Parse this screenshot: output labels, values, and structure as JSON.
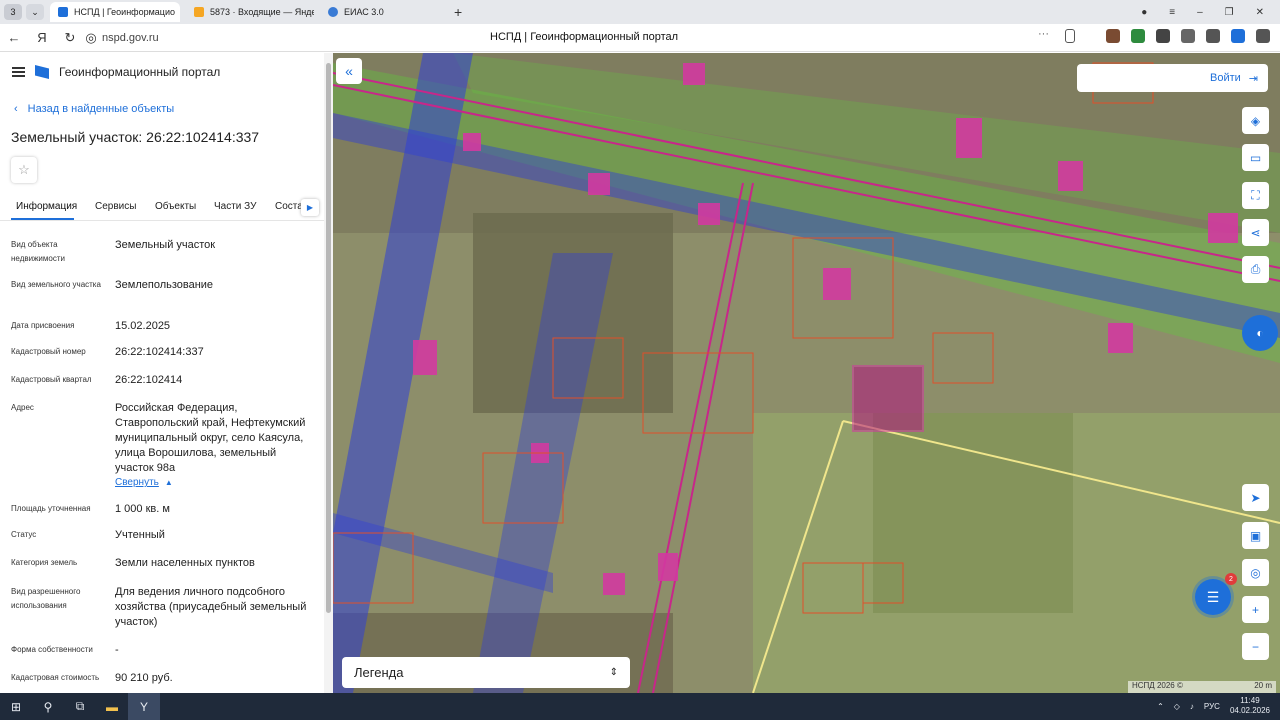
{
  "browser": {
    "tab_count": "3",
    "tabs": [
      {
        "label": "НСПД | Геоинформацио"
      },
      {
        "label": "5873 · Входящие — Яндек"
      },
      {
        "label": "ЕИАС 3.0"
      }
    ],
    "url": "nspd.gov.ru",
    "page_title": "НСПД | Геоинформационный портал"
  },
  "panel": {
    "portal_title": "Геоинформационный портал",
    "back_label": "Назад в найденные объекты",
    "object_title": "Земельный участок: 26:22:102414:337",
    "tabs": [
      "Информация",
      "Сервисы",
      "Объекты",
      "Части ЗУ",
      "Соста"
    ],
    "rows": [
      {
        "label": "Вид объекта недвижимости",
        "value": "Земельный участок"
      },
      {
        "label": "Вид земельного участка",
        "value": "Землепользование"
      },
      {
        "label": "Дата присвоения",
        "value": "15.02.2025"
      },
      {
        "label": "Кадастровый номер",
        "value": "26:22:102414:337"
      },
      {
        "label": "Кадастровый квартал",
        "value": "26:22:102414"
      },
      {
        "label": "Адрес",
        "value": "Российская Федерация, Ставропольский край, Нефтекумский муниципальный округ, село Каясула, улица Ворошилова, земельный участок 98а"
      },
      {
        "label": "Площадь уточненная",
        "value": "1 000 кв. м"
      },
      {
        "label": "Статус",
        "value": "Учтенный"
      },
      {
        "label": "Категория земель",
        "value": "Земли населенных пунктов"
      },
      {
        "label": "Вид разрешенного использования",
        "value": "Для ведения личного подсобного хозяйства (приусадебный земельный участок)"
      },
      {
        "label": "Форма собственности",
        "value": "-"
      },
      {
        "label": "Кадастровая стоимость",
        "value": "90 210 руб."
      }
    ],
    "collapse_label": "Свернуть"
  },
  "map": {
    "login_label": "Войти",
    "legend_label": "Легенда",
    "chat_badge": "2",
    "attribution": "НСПД 2026 ©",
    "scale": "20 m"
  },
  "taskbar": {
    "lang": "РУС",
    "time": "11:49",
    "date": "04.02.2026"
  },
  "colors": {
    "accent": "#1e6fd9",
    "parcel_magenta": "#b2157f",
    "road_blue": "#2f3fd6",
    "zone_green": "#5fcf3a"
  }
}
